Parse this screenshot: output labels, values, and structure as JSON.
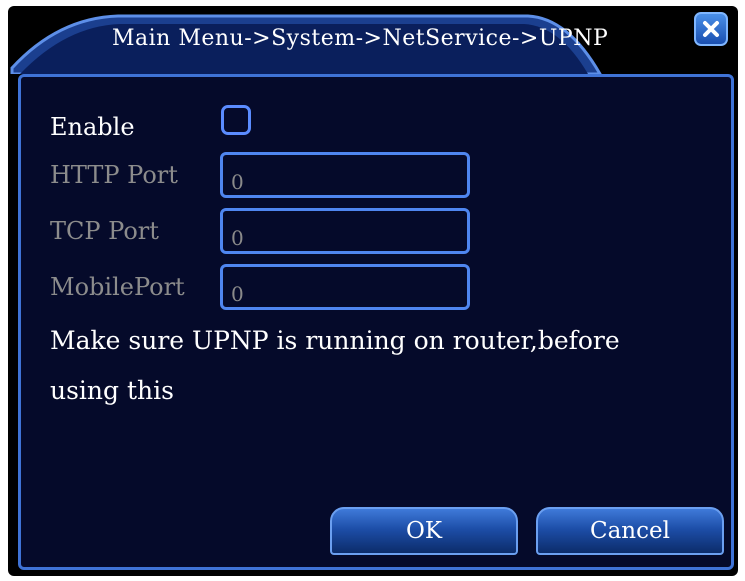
{
  "window": {
    "title": "Main Menu->System->NetService->UPNP"
  },
  "form": {
    "enable_label": "Enable",
    "enable_checked": false,
    "http_port_label": "HTTP Port",
    "http_port_value": "0",
    "tcp_port_label": "TCP Port",
    "tcp_port_value": "0",
    "mobile_port_label": "MobilePort",
    "mobile_port_value": "0"
  },
  "message": {
    "line1": "Make sure UPNP is running on router,before",
    "line2": "using this"
  },
  "buttons": {
    "ok_label": "OK",
    "cancel_label": "Cancel"
  },
  "colors": {
    "panel_background": "#050a2a",
    "border_accent": "#3f73d6",
    "disabled_text": "#8c8c8c"
  },
  "icons": {
    "close": "close-icon"
  }
}
